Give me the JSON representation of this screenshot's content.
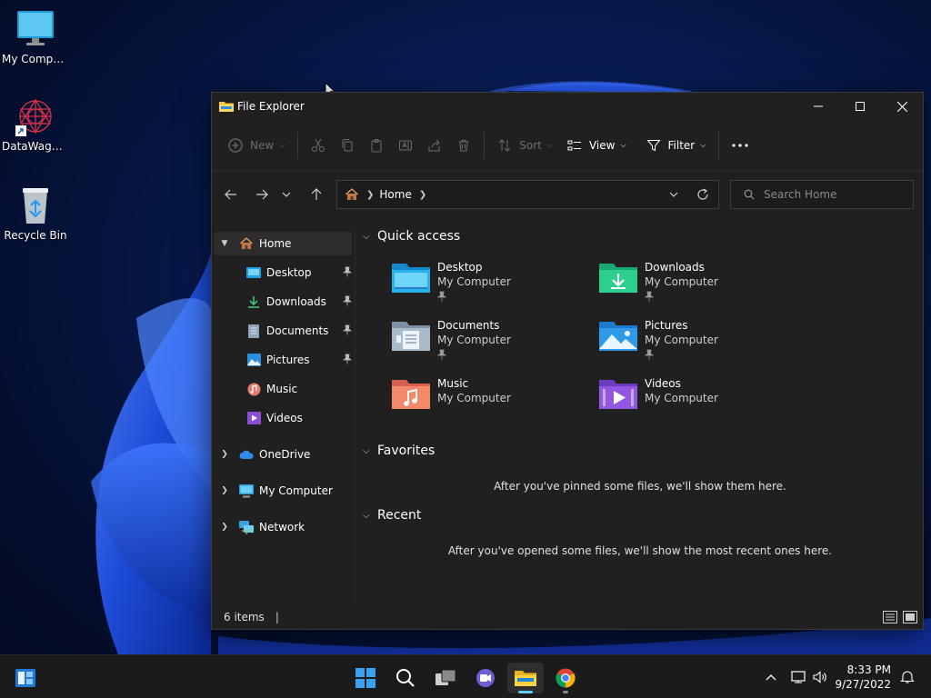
{
  "desktop": {
    "icons": [
      {
        "label": "My Computer"
      },
      {
        "label": "DataWagon..."
      },
      {
        "label": "Recycle Bin"
      }
    ]
  },
  "window": {
    "title": "File Explorer",
    "toolbar": {
      "new_label": "New",
      "sort_label": "Sort",
      "view_label": "View",
      "filter_label": "Filter"
    },
    "address": {
      "crumb": "Home"
    },
    "search": {
      "placeholder": "Search Home"
    },
    "sidebar": {
      "home": "Home",
      "pinned": [
        {
          "label": "Desktop",
          "pinned": true
        },
        {
          "label": "Downloads",
          "pinned": true
        },
        {
          "label": "Documents",
          "pinned": true
        },
        {
          "label": "Pictures",
          "pinned": true
        },
        {
          "label": "Music",
          "pinned": false
        },
        {
          "label": "Videos",
          "pinned": false
        }
      ],
      "roots": [
        {
          "label": "OneDrive"
        },
        {
          "label": "My Computer"
        },
        {
          "label": "Network"
        }
      ]
    },
    "quick_access": {
      "title": "Quick access",
      "items": [
        {
          "name": "Desktop",
          "location": "My Computer",
          "pinned": true
        },
        {
          "name": "Downloads",
          "location": "My Computer",
          "pinned": true
        },
        {
          "name": "Documents",
          "location": "My Computer",
          "pinned": true
        },
        {
          "name": "Pictures",
          "location": "My Computer",
          "pinned": true
        },
        {
          "name": "Music",
          "location": "My Computer",
          "pinned": false
        },
        {
          "name": "Videos",
          "location": "My Computer",
          "pinned": false
        }
      ]
    },
    "favorites": {
      "title": "Favorites",
      "empty": "After you've pinned some files, we'll show them here."
    },
    "recent": {
      "title": "Recent",
      "empty": "After you've opened some files, we'll show the most recent ones here."
    },
    "status": {
      "count": "6 items"
    }
  },
  "taskbar": {
    "time": "8:33 PM",
    "date": "9/27/2022"
  },
  "colors": {
    "accent": "#60cdff",
    "window_bg": "#202020",
    "taskbar_bg": "#1b1b1b"
  }
}
